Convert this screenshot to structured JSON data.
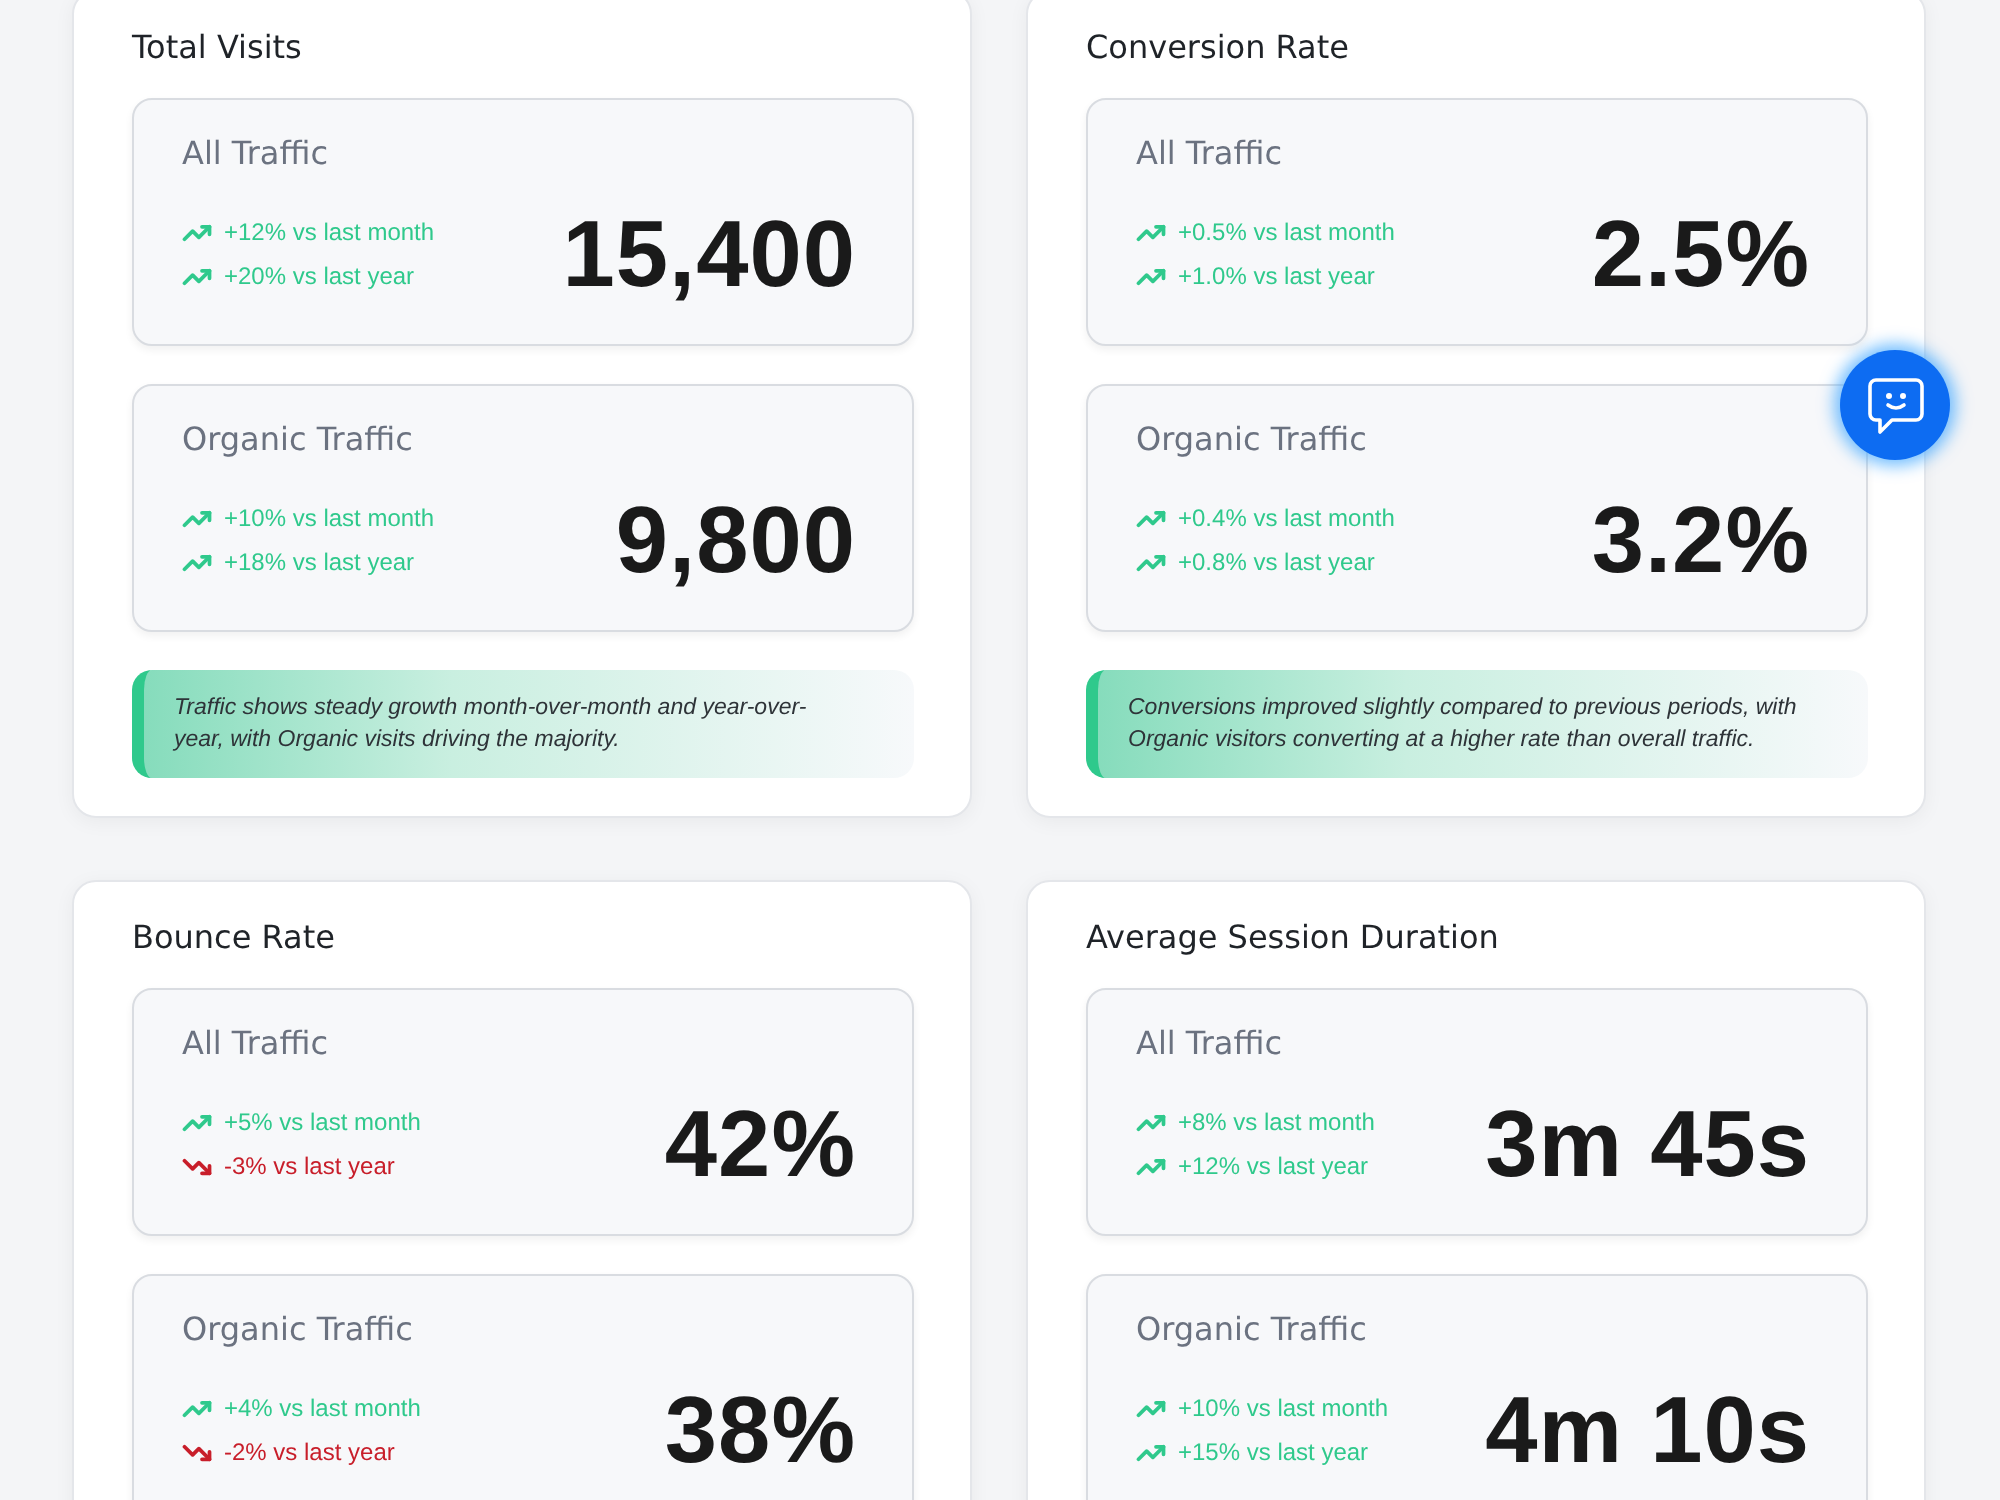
{
  "panels": [
    {
      "title": "Total Visits",
      "segments": [
        {
          "label": "All Traffic",
          "value": "15,400",
          "trends": [
            {
              "kind": "up",
              "text": "+12% vs last month"
            },
            {
              "kind": "up",
              "text": "+20% vs last year"
            }
          ]
        },
        {
          "label": "Organic Traffic",
          "value": "9,800",
          "trends": [
            {
              "kind": "up",
              "text": "+10% vs last month"
            },
            {
              "kind": "up",
              "text": "+18% vs last year"
            }
          ]
        }
      ],
      "note": "Traffic shows steady growth month-over-month and year-over-year, with Organic visits driving the majority."
    },
    {
      "title": "Conversion Rate",
      "segments": [
        {
          "label": "All Traffic",
          "value": "2.5%",
          "trends": [
            {
              "kind": "up",
              "text": "+0.5% vs last month"
            },
            {
              "kind": "up",
              "text": "+1.0% vs last year"
            }
          ]
        },
        {
          "label": "Organic Traffic",
          "value": "3.2%",
          "trends": [
            {
              "kind": "up",
              "text": "+0.4% vs last month"
            },
            {
              "kind": "up",
              "text": "+0.8% vs last year"
            }
          ]
        }
      ],
      "note": "Conversions improved slightly compared to previous periods, with Organic visitors converting at a higher rate than overall traffic."
    },
    {
      "title": "Bounce Rate",
      "segments": [
        {
          "label": "All Traffic",
          "value": "42%",
          "trends": [
            {
              "kind": "up",
              "text": "+5% vs last month"
            },
            {
              "kind": "down",
              "text": "-3% vs last year"
            }
          ]
        },
        {
          "label": "Organic Traffic",
          "value": "38%",
          "trends": [
            {
              "kind": "up",
              "text": "+4% vs last month"
            },
            {
              "kind": "down",
              "text": "-2% vs last year"
            }
          ]
        }
      ]
    },
    {
      "title": "Average Session Duration",
      "segments": [
        {
          "label": "All Traffic",
          "value": "3m 45s",
          "trends": [
            {
              "kind": "up",
              "text": "+8% vs last month"
            },
            {
              "kind": "up",
              "text": "+12% vs last year"
            }
          ]
        },
        {
          "label": "Organic Traffic",
          "value": "4m 10s",
          "trends": [
            {
              "kind": "up",
              "text": "+10% vs last month"
            },
            {
              "kind": "up",
              "text": "+15% vs last year"
            }
          ]
        }
      ]
    }
  ]
}
